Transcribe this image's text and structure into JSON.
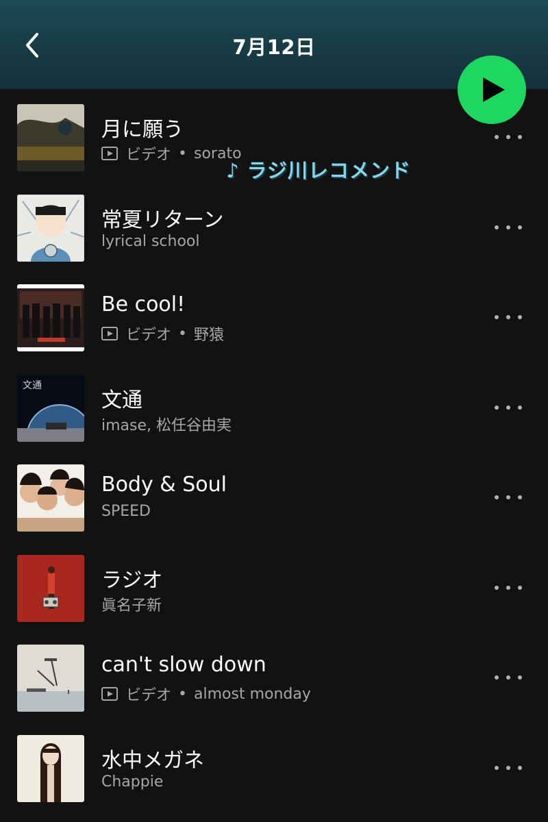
{
  "header": {
    "title": "7月12日"
  },
  "overlay_text": "♪ ラジ川レコメンド",
  "video_label": "ビデオ",
  "separator": "•",
  "tracks": [
    {
      "title": "月に願う",
      "is_video": true,
      "artist": "sorato"
    },
    {
      "title": "常夏リターン",
      "is_video": false,
      "artist": "lyrical school"
    },
    {
      "title": "Be cool!",
      "is_video": true,
      "artist": "野猿"
    },
    {
      "title": "文通",
      "is_video": false,
      "artist": "imase, 松任谷由実"
    },
    {
      "title": "Body & Soul",
      "is_video": false,
      "artist": "SPEED"
    },
    {
      "title": "ラジオ",
      "is_video": false,
      "artist": "眞名子新"
    },
    {
      "title": "can't slow down",
      "is_video": true,
      "artist": "almost monday"
    },
    {
      "title": "水中メガネ",
      "is_video": false,
      "artist": "Chappie"
    }
  ],
  "colors": {
    "accent": "#1ed760",
    "header_top": "#1b4a55",
    "background": "#121212",
    "overlay": "#8ad6e8"
  }
}
